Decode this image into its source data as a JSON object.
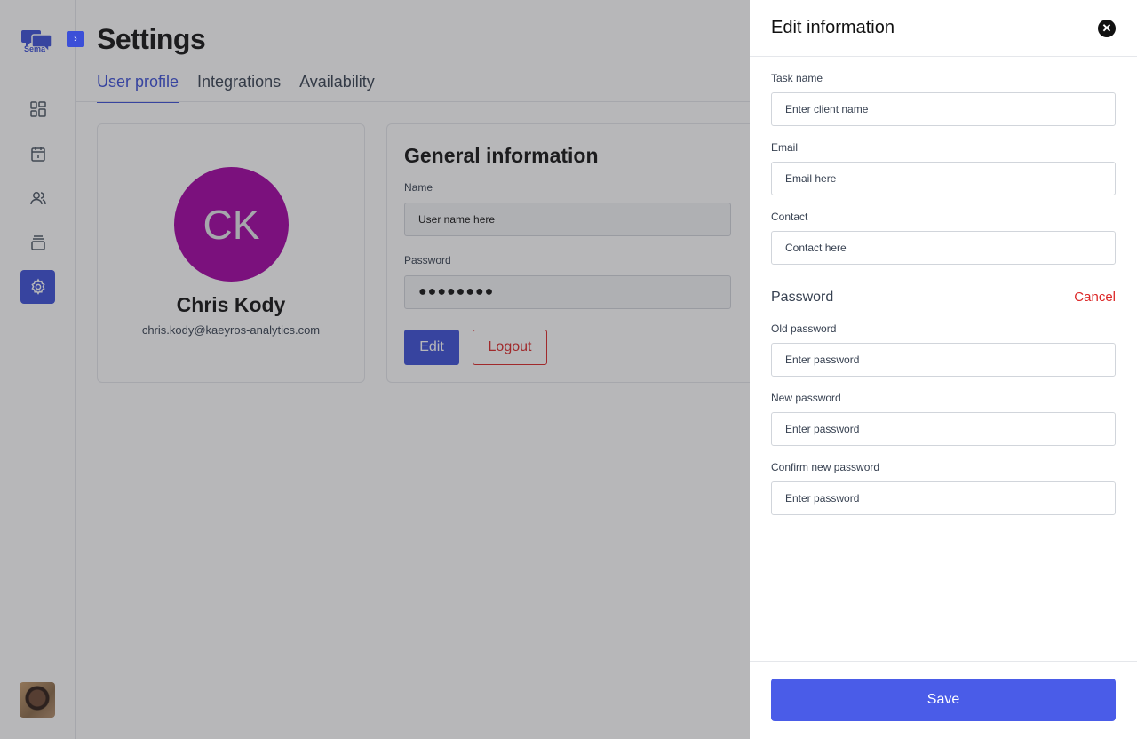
{
  "app": {
    "logo_text": "Sema"
  },
  "sidebar": {
    "expand_icon": "chevron-right-icon",
    "items": [
      {
        "name": "dashboard",
        "icon": "grid-icon",
        "active": false
      },
      {
        "name": "calendar",
        "icon": "calendar-icon",
        "active": false
      },
      {
        "name": "users",
        "icon": "users-icon",
        "active": false
      },
      {
        "name": "stack",
        "icon": "layers-icon",
        "active": false
      },
      {
        "name": "settings",
        "icon": "gear-icon",
        "active": true
      }
    ]
  },
  "header": {
    "title": "Settings",
    "tabs": [
      {
        "label": "User profile",
        "active": true
      },
      {
        "label": "Integrations",
        "active": false
      },
      {
        "label": "Availability",
        "active": false
      }
    ]
  },
  "profile": {
    "initials": "CK",
    "name": "Chris Kody",
    "email": "chris.kody@kaeyros-analytics.com",
    "avatar_color": "#a400a4"
  },
  "general": {
    "title": "General information",
    "name_label": "Name",
    "name_value": "User name here",
    "password_label": "Password",
    "password_value": "●●●●●●●●",
    "edit_label": "Edit",
    "logout_label": "Logout"
  },
  "drawer": {
    "title": "Edit information",
    "close_icon": "close-icon",
    "task_label": "Task name",
    "task_placeholder": "Enter client name",
    "email_label": "Email",
    "email_placeholder": "Email here",
    "contact_label": "Contact",
    "contact_placeholder": "Contact here",
    "password_heading": "Password",
    "cancel_label": "Cancel",
    "old_password_label": "Old password",
    "new_password_label": "New password",
    "confirm_password_label": "Confirm new password",
    "password_placeholder": "Enter password",
    "save_label": "Save"
  },
  "colors": {
    "accent": "#3b4fd8",
    "danger": "#dc2626",
    "save": "#4a5ce8"
  }
}
